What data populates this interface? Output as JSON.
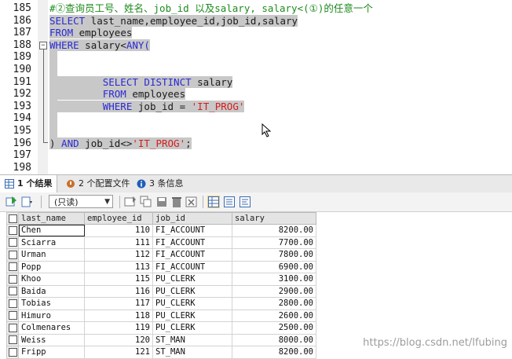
{
  "editor": {
    "lines": [
      {
        "num": "185",
        "segments": [
          {
            "t": "#②查询员工号、姓名、job_id 以及salary, salary<(①)的任意一个",
            "c": "cmt"
          }
        ]
      },
      {
        "num": "186",
        "segments": [
          {
            "t": "SELECT",
            "c": "kw"
          },
          {
            "t": " last_name,employee_id,job_id,salary",
            "c": "plain"
          }
        ]
      },
      {
        "num": "187",
        "segments": [
          {
            "t": "FROM",
            "c": "kw"
          },
          {
            "t": " employees",
            "c": "plain"
          }
        ]
      },
      {
        "num": "188",
        "segments": [
          {
            "t": "WHERE",
            "c": "kw"
          },
          {
            "t": " salary<",
            "c": "plain"
          },
          {
            "t": "ANY(",
            "c": "kw"
          }
        ]
      },
      {
        "num": "189",
        "segments": []
      },
      {
        "num": "190",
        "segments": []
      },
      {
        "num": "191",
        "segments": [
          {
            "t": "         ",
            "c": "plain"
          },
          {
            "t": "SELECT DISTINCT",
            "c": "kw"
          },
          {
            "t": " salary",
            "c": "plain"
          }
        ]
      },
      {
        "num": "192",
        "segments": [
          {
            "t": "         ",
            "c": "plain"
          },
          {
            "t": "FROM",
            "c": "kw"
          },
          {
            "t": " employees",
            "c": "plain"
          }
        ]
      },
      {
        "num": "193",
        "segments": [
          {
            "t": "         ",
            "c": "plain"
          },
          {
            "t": "WHERE",
            "c": "kw"
          },
          {
            "t": " job_id = ",
            "c": "plain"
          },
          {
            "t": "'IT_PROG'",
            "c": "str"
          }
        ]
      },
      {
        "num": "194",
        "segments": []
      },
      {
        "num": "195",
        "segments": []
      },
      {
        "num": "196",
        "segments": [
          {
            "t": ")",
            "c": "plain"
          },
          {
            "t": " AND",
            "c": "kw"
          },
          {
            "t": " job_id<>",
            "c": "plain"
          },
          {
            "t": "'IT_PROG'",
            "c": "str"
          },
          {
            "t": ";",
            "c": "plain"
          }
        ]
      },
      {
        "num": "197",
        "segments": []
      },
      {
        "num": "198",
        "segments": []
      }
    ],
    "fold_symbol": "−"
  },
  "tabs": [
    {
      "label": "1 个结果",
      "icon": "results-grid-icon",
      "active": true
    },
    {
      "label": "2 个配置文件",
      "icon": "profile-icon",
      "active": false
    },
    {
      "label": "3 条信息",
      "icon": "info-icon",
      "active": false
    }
  ],
  "toolbar": {
    "readonly_label": "(只读)"
  },
  "grid": {
    "columns": [
      "last_name",
      "employee_id",
      "job_id",
      "salary"
    ],
    "rows": [
      [
        "Chen",
        "110",
        "FI_ACCOUNT",
        "8200.00"
      ],
      [
        "Sciarra",
        "111",
        "FI_ACCOUNT",
        "7700.00"
      ],
      [
        "Urman",
        "112",
        "FI_ACCOUNT",
        "7800.00"
      ],
      [
        "Popp",
        "113",
        "FI_ACCOUNT",
        "6900.00"
      ],
      [
        "Khoo",
        "115",
        "PU_CLERK",
        "3100.00"
      ],
      [
        "Baida",
        "116",
        "PU_CLERK",
        "2900.00"
      ],
      [
        "Tobias",
        "117",
        "PU_CLERK",
        "2800.00"
      ],
      [
        "Himuro",
        "118",
        "PU_CLERK",
        "2600.00"
      ],
      [
        "Colmenares",
        "119",
        "PU_CLERK",
        "2500.00"
      ],
      [
        "Weiss",
        "120",
        "ST_MAN",
        "8000.00"
      ],
      [
        "Fripp",
        "121",
        "ST_MAN",
        "8200.00"
      ]
    ]
  },
  "watermark": "https://blog.csdn.net/lfubing",
  "colors": {
    "keyword": "#2a2ad4",
    "string": "#d81c1c",
    "comment": "#1d8a1d",
    "selection": "#c8c8c8"
  }
}
